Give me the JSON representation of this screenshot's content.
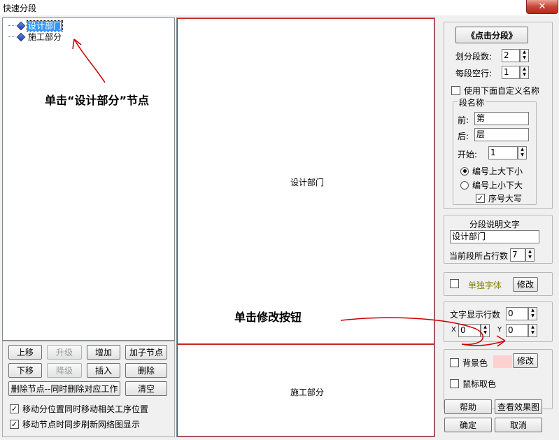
{
  "window": {
    "title": "快速分段",
    "close": "✕"
  },
  "tree": {
    "nodes": [
      {
        "label": "设计部门",
        "selected": true
      },
      {
        "label": "施工部分",
        "selected": false
      }
    ]
  },
  "annotations": {
    "click_node": "单击“设计部分”节点",
    "click_modify": "单击修改按钮"
  },
  "left_buttons": {
    "move_up": "上移",
    "promote": "升级",
    "add": "增加",
    "add_child": "加子节点",
    "move_down": "下移",
    "demote": "降级",
    "insert": "插入",
    "delete": "删除",
    "delete_node_work": "删除节点--同时删除对应工作",
    "clear": "清空"
  },
  "left_checks": {
    "move_pos": "移动分位置同时移动相关工序位置",
    "sync_refresh": "移动节点时同步刷新网络图显示"
  },
  "preview": {
    "segments": [
      "设计部门",
      "施工部分"
    ]
  },
  "right": {
    "click_segment": "《点击分段》",
    "seg_count_label": "划分段数:",
    "seg_count_value": "2",
    "blank_rows_label": "每段空行:",
    "blank_rows_value": "1",
    "use_custom_name": "使用下面自定义名称",
    "seg_name_group": "段名称",
    "prefix_label": "前:",
    "prefix_value": "第",
    "suffix_label": "后:",
    "suffix_value": "层",
    "start_label": "开始:",
    "start_value": "1",
    "order_desc": "编号上大下小",
    "order_asc": "编号上小下大",
    "seq_upper": "序号大写",
    "desc_title": "分段说明文字",
    "desc_value": "设计部门",
    "rows_label": "当前段所占行数",
    "rows_value": "7",
    "single_font": "单独字体",
    "modify": "修改",
    "text_rows_label": "文字显示行数",
    "text_rows_value": "0",
    "x_label": "X",
    "x_value": "0",
    "y_label": "Y",
    "y_value": "0",
    "bg_color": "背景色",
    "mouse_color": "鼠标取色",
    "help": "帮助",
    "view_effect": "查看效果图",
    "ok": "确定",
    "cancel": "取消"
  },
  "colors": {
    "annotation_arrow": "#cc0000",
    "segment_border": "#cc2222",
    "swatch": "#ffd0d0",
    "single_font_text": "#808000"
  }
}
